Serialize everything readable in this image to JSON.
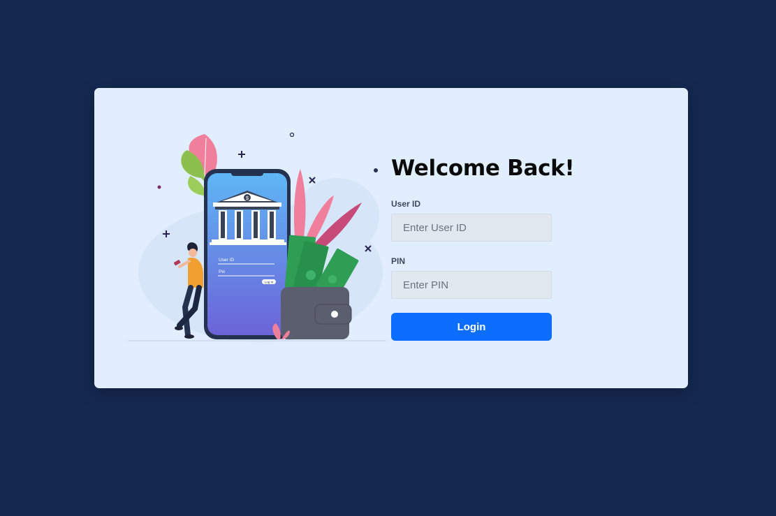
{
  "login": {
    "title": "Welcome Back!",
    "user_id_label": "User ID",
    "user_id_placeholder": "Enter User ID",
    "pin_label": "PIN",
    "pin_placeholder": "Enter PIN",
    "login_button": "Login"
  },
  "illustration": {
    "phone_user_label": "User ID",
    "phone_pin_label": "Pin",
    "phone_login_label": "Log in",
    "bank_symbol": "$",
    "icons": [
      "bank-icon",
      "wallet-icon",
      "money-icon",
      "person-icon",
      "leaf-icon"
    ]
  },
  "colors": {
    "background": "#152850",
    "card": "#e0eefd",
    "accent": "#0d6efd",
    "input_bg": "#e2e8f0"
  }
}
